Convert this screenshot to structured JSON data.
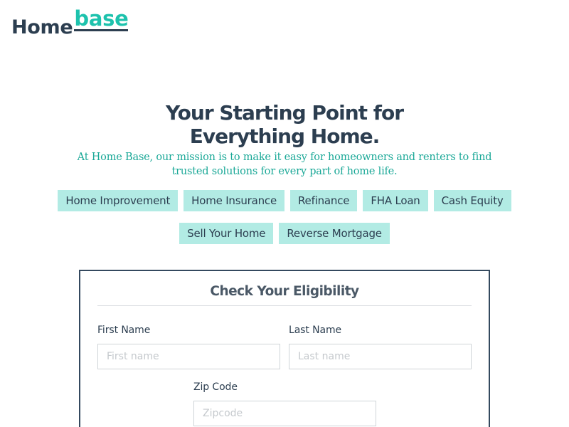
{
  "logo": {
    "part1": "Home",
    "part2": "base"
  },
  "hero": {
    "title_line1": "Your Starting Point for",
    "title_line2": "Everything Home.",
    "subtitle": "At Home Base, our mission is to make it easy for homeowners and renters to find trusted solutions for every part of home life."
  },
  "categories": {
    "row1": [
      "Home Improvement",
      "Home Insurance",
      "Refinance",
      "FHA Loan",
      "Cash Equity"
    ],
    "row2": [
      "Sell Your Home",
      "Reverse Mortgage"
    ]
  },
  "form": {
    "title": "Check Your Eligibility",
    "first_name": {
      "label": "First Name",
      "placeholder": "First name",
      "value": ""
    },
    "last_name": {
      "label": "Last Name",
      "placeholder": "Last name",
      "value": ""
    },
    "zip": {
      "label": "Zip Code",
      "placeholder": "Zipcode",
      "value": ""
    }
  },
  "colors": {
    "brand_dark": "#2c3e50",
    "brand_teal": "#1dc2ad",
    "chip_bg": "#b2ebe4"
  }
}
